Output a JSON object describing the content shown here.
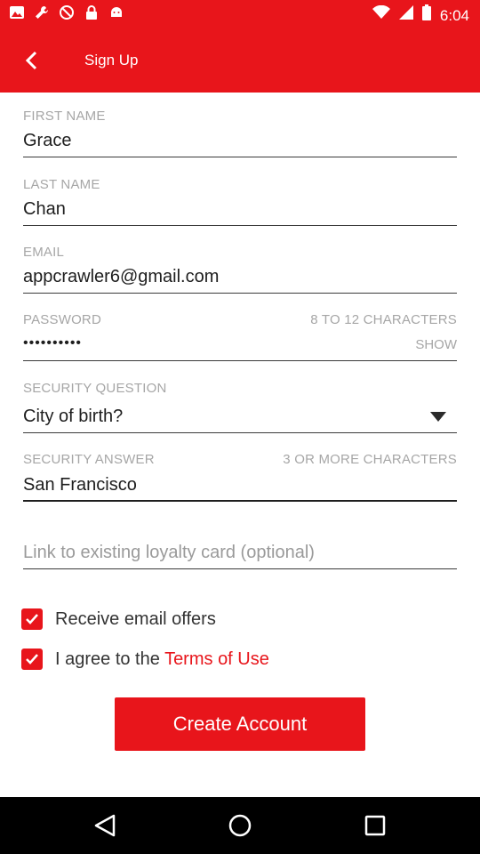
{
  "status_bar": {
    "time": "6:04",
    "notification_icons": [
      "photo-icon",
      "wrench-icon",
      "blocked-icon",
      "lock-icon",
      "android-icon"
    ],
    "system_icons": [
      "wifi-icon",
      "signal-icon",
      "battery-icon"
    ]
  },
  "app_bar": {
    "title": "Sign Up",
    "back_icon": "back-arrow-icon",
    "background_color": "#e8151b"
  },
  "form": {
    "first_name": {
      "label": "FIRST NAME",
      "value": "Grace"
    },
    "last_name": {
      "label": "LAST NAME",
      "value": "Chan"
    },
    "email": {
      "label": "EMAIL",
      "value": "appcrawler6@gmail.com"
    },
    "password": {
      "label": "PASSWORD",
      "hint": "8 TO 12 CHARACTERS",
      "value": "••••••••••",
      "toggle": "SHOW"
    },
    "security_question": {
      "label": "SECURITY QUESTION",
      "selected": "City of birth?"
    },
    "security_answer": {
      "label": "SECURITY ANSWER",
      "hint": "3 OR MORE CHARACTERS",
      "value": "San Francisco"
    },
    "loyalty_card": {
      "placeholder": "Link to existing loyalty card (optional)"
    }
  },
  "checkboxes": {
    "email_offers": {
      "label": "Receive email offers",
      "checked": true
    },
    "terms": {
      "prefix": "I agree to the ",
      "link": "Terms of Use",
      "checked": true
    }
  },
  "create_button": {
    "label": "Create Account"
  },
  "nav_bar": {
    "icons": [
      "back-triangle-icon",
      "home-circle-icon",
      "recents-square-icon"
    ]
  }
}
